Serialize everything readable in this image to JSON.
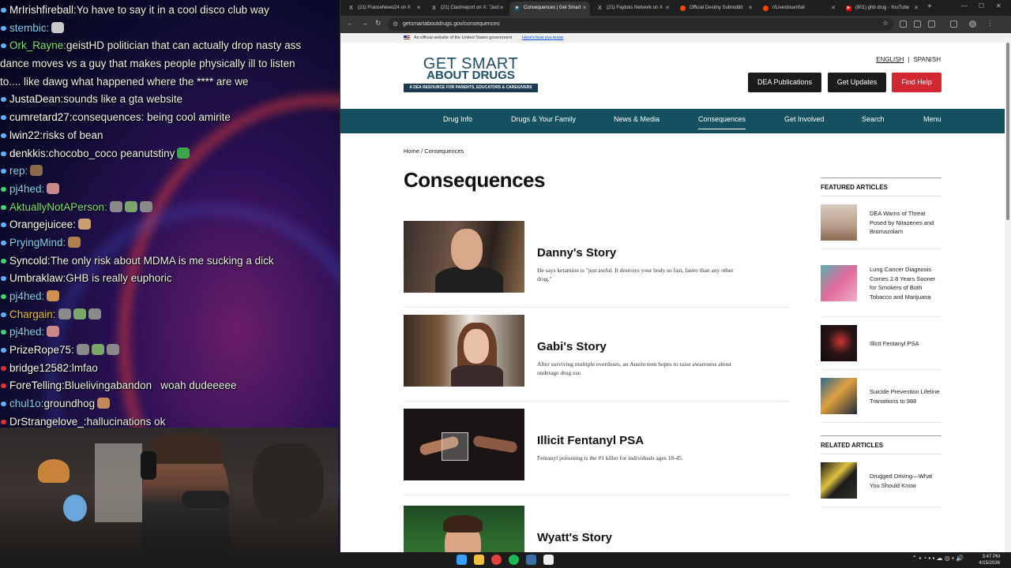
{
  "chat": [
    {
      "user": "MrIrishfireball",
      "msg": "Yo have to say it in a cool disco club way",
      "ucolor": "#ffffff",
      "dot": "#5ab4ff"
    },
    {
      "user": "stembic",
      "msg": "",
      "ucolor": "#7fd3ff",
      "dot": "#5ab4ff",
      "emotes": [
        "#c9c9c9"
      ]
    },
    {
      "user": "Ork_Rayne",
      "msg": "geistHD politician that can actually drop nasty ass",
      "ucolor": "#7be37b",
      "dot": "#5ab4ff"
    },
    {
      "user": "",
      "msg": "dance moves vs a guy that makes people physically ill to listen",
      "ucolor": "#ffffff",
      "dot": ""
    },
    {
      "user": "",
      "msg": "to.... like dawg what happened where the **** are we",
      "ucolor": "#ffffff",
      "dot": ""
    },
    {
      "user": "JustaDean",
      "msg": "sounds like a gta website",
      "ucolor": "#ffffff",
      "dot": "#5ab4ff"
    },
    {
      "user": "cumretard27",
      "msg": "consequences: being cool amirite",
      "ucolor": "#ffffff",
      "dot": "#5ab4ff"
    },
    {
      "user": "lwin22",
      "msg": "risks of bean",
      "ucolor": "#ffffff",
      "dot": "#5ab4ff"
    },
    {
      "user": "denkkis",
      "msg": "chocobo_coco peanutstiny",
      "ucolor": "#ffffff",
      "dot": "#5ab4ff",
      "emotes": [
        "#3da64a"
      ]
    },
    {
      "user": "rep",
      "msg": "",
      "ucolor": "#7fd3ff",
      "dot": "#5ab4ff",
      "emotes": [
        "#8a6a4a"
      ]
    },
    {
      "user": "pj4hed",
      "msg": "",
      "ucolor": "#7fd3ff",
      "dot": "#3dd66e",
      "emotes": [
        "#c98a8a"
      ]
    },
    {
      "user": "AktuallyNotAPerson",
      "msg": "",
      "ucolor": "#7be37b",
      "dot": "#3dd66e",
      "emotes": [
        "#8a8a8a",
        "#7aa86a",
        "#8a8a8a"
      ]
    },
    {
      "user": "Orangejuicee",
      "msg": "",
      "ucolor": "#ffffff",
      "dot": "#5ab4ff",
      "emotes": [
        "#c9a070"
      ]
    },
    {
      "user": "PryingMind",
      "msg": "",
      "ucolor": "#7fd3ff",
      "dot": "#5ab4ff",
      "emotes": [
        "#b08050"
      ]
    },
    {
      "user": "Syncold",
      "msg": "The only risk about MDMA is me sucking a dick",
      "ucolor": "#ffffff",
      "dot": "#3dd66e"
    },
    {
      "user": "Umbraklaw",
      "msg": "GHB is really euphoric",
      "ucolor": "#ffffff",
      "dot": "#5ab4ff"
    },
    {
      "user": "pj4hed",
      "msg": "",
      "ucolor": "#7fd3ff",
      "dot": "#3dd66e",
      "emotes": [
        "#d09050"
      ]
    },
    {
      "user": "Chargain",
      "msg": "",
      "ucolor": "#f0c040",
      "dot": "#5ab4ff",
      "emotes": [
        "#8a8a8a",
        "#7aa86a",
        "#8a8a8a"
      ]
    },
    {
      "user": "pj4hed",
      "msg": "",
      "ucolor": "#7fd3ff",
      "dot": "#3dd66e",
      "emotes": [
        "#c98a8a"
      ]
    },
    {
      "user": "PrizeRope75",
      "msg": "",
      "ucolor": "#ffffff",
      "dot": "#5ab4ff",
      "emotes": [
        "#8a8a8a",
        "#7aa86a",
        "#8a8a8a"
      ]
    },
    {
      "user": "bridge12582",
      "msg": "lmfao",
      "ucolor": "#ffffff",
      "dot": "#e03030"
    },
    {
      "user": "ForeTelling",
      "msg": "Bluelivingabandon   woah dudeeeee",
      "ucolor": "#ffffff",
      "dot": "#e03030"
    },
    {
      "user": "chul1o",
      "msg": "groundhog",
      "ucolor": "#7fd3ff",
      "dot": "#5ab4ff",
      "emotes": [
        "#c08a5a"
      ]
    },
    {
      "user": "DrStrangelove_",
      "msg": "hallucinations ok",
      "ucolor": "#ffffff",
      "dot": "#e03030"
    }
  ],
  "tabs": [
    {
      "label": "(21) FranceNews24 on X",
      "icon": "X",
      "icolor": "#000"
    },
    {
      "label": "(21) Clashreport on X: \"Just",
      "icon": "X",
      "icolor": "#000"
    },
    {
      "label": "Consequences | Get Smart",
      "icon": "✶",
      "icolor": "#1d4f6a"
    },
    {
      "label": "(21) Faytuks Network on X",
      "icon": "X",
      "icolor": "#000"
    },
    {
      "label": "Official Destiny Subreddit",
      "icon": "●",
      "icolor": "#ff4500"
    },
    {
      "label": "r/Livestreamfail",
      "icon": "●",
      "icolor": "#ff4500"
    },
    {
      "label": "(801) ghb drug - YouTube",
      "icon": "▶",
      "icolor": "#ff0000"
    }
  ],
  "url": "getsmartaboutdrugs.gov/consequences",
  "gov_banner": {
    "text": "An official website of the United States government",
    "link": "Here's how you know"
  },
  "logo": {
    "line1": "GET SMART",
    "line2": "ABOUT DRUGS",
    "tagline": "A DEA RESOURCE FOR PARENTS, EDUCATORS & CAREGIVERS"
  },
  "lang": {
    "english": "ENGLISH",
    "spanish": "SPANISH"
  },
  "header_buttons": {
    "pubs": "DEA Publications",
    "updates": "Get Updates",
    "help": "Find Help"
  },
  "nav": [
    "Drug Info",
    "Drugs & Your Family",
    "News & Media",
    "Consequences",
    "Get Involved",
    "Search",
    "Menu"
  ],
  "breadcrumb": "Home / Consequences",
  "page_title": "Consequences",
  "stories": [
    {
      "title": "Danny's Story",
      "desc": "He says ketamine is \"just awful. It destroys your body so fast, faster than any other drug.\""
    },
    {
      "title": "Gabi's Story",
      "desc": "After surviving multiple overdoses, an Austin teen hopes to raise awareness about underage drug use."
    },
    {
      "title": "Illicit Fentanyl PSA",
      "desc": "Fentanyl poisoning is the #1 killer for individuals ages 18-45."
    },
    {
      "title": "Wyatt's Story",
      "desc": ""
    }
  ],
  "sidebar": {
    "featured_heading": "FEATURED ARTICLES",
    "featured": [
      "DEA Warns of Threat Posed by Nitazenes and Bromazolam",
      "Lung Cancer Diagnosis Comes 2.8 Years Sooner for Smokers of Both Tobacco and Marijuana",
      "Illicit Fentanyl PSA",
      "Suicide Prevention Lifeline Transitions to 988"
    ],
    "related_heading": "RELATED ARTICLES",
    "related": [
      "Drugged Driving—What You Should Know"
    ]
  },
  "clock": {
    "time": "3:47 PM",
    "date": "4/15/2026"
  }
}
